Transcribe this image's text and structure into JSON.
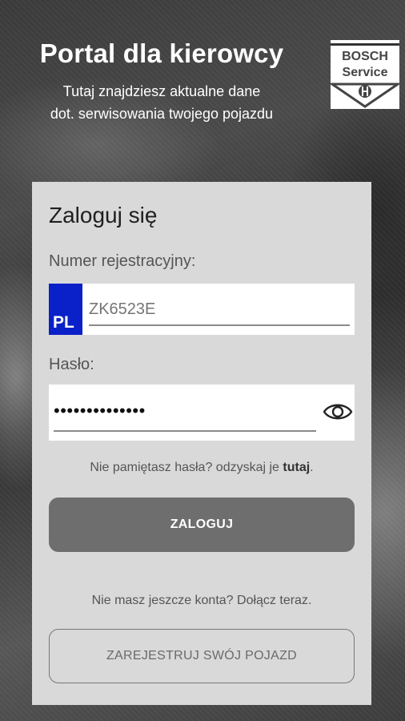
{
  "header": {
    "title": "Portal dla kierowcy",
    "subtitle_line1": "Tutaj znajdziesz aktualne dane",
    "subtitle_line2": "dot. serwisowania twojego pojazdu"
  },
  "logo": {
    "brand": "BOSCH",
    "service": "Service"
  },
  "login": {
    "title": "Zaloguj się",
    "registration_label": "Numer rejestracyjny:",
    "country_badge": "PL",
    "registration_value": "ZK6523E",
    "password_label": "Hasło:",
    "password_value": "••••••••••••••",
    "forgot_text": "Nie pamiętasz hasła? odzyskaj je ",
    "forgot_link": "tutaj",
    "forgot_suffix": ".",
    "login_button": "ZALOGUJ",
    "no_account_text": "Nie masz jeszcze konta? Dołącz teraz.",
    "register_button": "ZAREJESTRUJ SWÓJ POJAZD"
  },
  "colors": {
    "plate_blue": "#0a20c8",
    "card_bg": "#d9d9d9",
    "button_gray": "#6e6e6e"
  },
  "icons": {
    "password_toggle": "eye-icon",
    "logo_emblem": "bosch-armature-icon"
  }
}
